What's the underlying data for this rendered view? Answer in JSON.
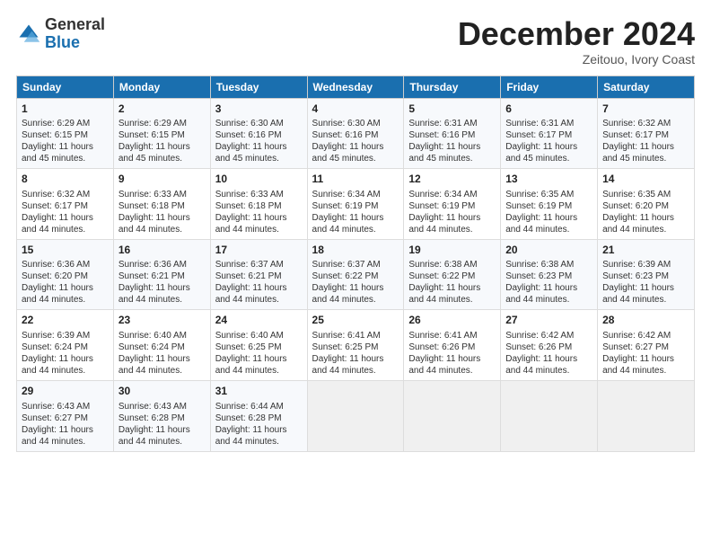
{
  "logo": {
    "general": "General",
    "blue": "Blue"
  },
  "title": "December 2024",
  "subtitle": "Zeitouo, Ivory Coast",
  "headers": [
    "Sunday",
    "Monday",
    "Tuesday",
    "Wednesday",
    "Thursday",
    "Friday",
    "Saturday"
  ],
  "weeks": [
    [
      {
        "day": "1",
        "lines": [
          "Sunrise: 6:29 AM",
          "Sunset: 6:15 PM",
          "Daylight: 11 hours",
          "and 45 minutes."
        ]
      },
      {
        "day": "2",
        "lines": [
          "Sunrise: 6:29 AM",
          "Sunset: 6:15 PM",
          "Daylight: 11 hours",
          "and 45 minutes."
        ]
      },
      {
        "day": "3",
        "lines": [
          "Sunrise: 6:30 AM",
          "Sunset: 6:16 PM",
          "Daylight: 11 hours",
          "and 45 minutes."
        ]
      },
      {
        "day": "4",
        "lines": [
          "Sunrise: 6:30 AM",
          "Sunset: 6:16 PM",
          "Daylight: 11 hours",
          "and 45 minutes."
        ]
      },
      {
        "day": "5",
        "lines": [
          "Sunrise: 6:31 AM",
          "Sunset: 6:16 PM",
          "Daylight: 11 hours",
          "and 45 minutes."
        ]
      },
      {
        "day": "6",
        "lines": [
          "Sunrise: 6:31 AM",
          "Sunset: 6:17 PM",
          "Daylight: 11 hours",
          "and 45 minutes."
        ]
      },
      {
        "day": "7",
        "lines": [
          "Sunrise: 6:32 AM",
          "Sunset: 6:17 PM",
          "Daylight: 11 hours",
          "and 45 minutes."
        ]
      }
    ],
    [
      {
        "day": "8",
        "lines": [
          "Sunrise: 6:32 AM",
          "Sunset: 6:17 PM",
          "Daylight: 11 hours",
          "and 44 minutes."
        ]
      },
      {
        "day": "9",
        "lines": [
          "Sunrise: 6:33 AM",
          "Sunset: 6:18 PM",
          "Daylight: 11 hours",
          "and 44 minutes."
        ]
      },
      {
        "day": "10",
        "lines": [
          "Sunrise: 6:33 AM",
          "Sunset: 6:18 PM",
          "Daylight: 11 hours",
          "and 44 minutes."
        ]
      },
      {
        "day": "11",
        "lines": [
          "Sunrise: 6:34 AM",
          "Sunset: 6:19 PM",
          "Daylight: 11 hours",
          "and 44 minutes."
        ]
      },
      {
        "day": "12",
        "lines": [
          "Sunrise: 6:34 AM",
          "Sunset: 6:19 PM",
          "Daylight: 11 hours",
          "and 44 minutes."
        ]
      },
      {
        "day": "13",
        "lines": [
          "Sunrise: 6:35 AM",
          "Sunset: 6:19 PM",
          "Daylight: 11 hours",
          "and 44 minutes."
        ]
      },
      {
        "day": "14",
        "lines": [
          "Sunrise: 6:35 AM",
          "Sunset: 6:20 PM",
          "Daylight: 11 hours",
          "and 44 minutes."
        ]
      }
    ],
    [
      {
        "day": "15",
        "lines": [
          "Sunrise: 6:36 AM",
          "Sunset: 6:20 PM",
          "Daylight: 11 hours",
          "and 44 minutes."
        ]
      },
      {
        "day": "16",
        "lines": [
          "Sunrise: 6:36 AM",
          "Sunset: 6:21 PM",
          "Daylight: 11 hours",
          "and 44 minutes."
        ]
      },
      {
        "day": "17",
        "lines": [
          "Sunrise: 6:37 AM",
          "Sunset: 6:21 PM",
          "Daylight: 11 hours",
          "and 44 minutes."
        ]
      },
      {
        "day": "18",
        "lines": [
          "Sunrise: 6:37 AM",
          "Sunset: 6:22 PM",
          "Daylight: 11 hours",
          "and 44 minutes."
        ]
      },
      {
        "day": "19",
        "lines": [
          "Sunrise: 6:38 AM",
          "Sunset: 6:22 PM",
          "Daylight: 11 hours",
          "and 44 minutes."
        ]
      },
      {
        "day": "20",
        "lines": [
          "Sunrise: 6:38 AM",
          "Sunset: 6:23 PM",
          "Daylight: 11 hours",
          "and 44 minutes."
        ]
      },
      {
        "day": "21",
        "lines": [
          "Sunrise: 6:39 AM",
          "Sunset: 6:23 PM",
          "Daylight: 11 hours",
          "and 44 minutes."
        ]
      }
    ],
    [
      {
        "day": "22",
        "lines": [
          "Sunrise: 6:39 AM",
          "Sunset: 6:24 PM",
          "Daylight: 11 hours",
          "and 44 minutes."
        ]
      },
      {
        "day": "23",
        "lines": [
          "Sunrise: 6:40 AM",
          "Sunset: 6:24 PM",
          "Daylight: 11 hours",
          "and 44 minutes."
        ]
      },
      {
        "day": "24",
        "lines": [
          "Sunrise: 6:40 AM",
          "Sunset: 6:25 PM",
          "Daylight: 11 hours",
          "and 44 minutes."
        ]
      },
      {
        "day": "25",
        "lines": [
          "Sunrise: 6:41 AM",
          "Sunset: 6:25 PM",
          "Daylight: 11 hours",
          "and 44 minutes."
        ]
      },
      {
        "day": "26",
        "lines": [
          "Sunrise: 6:41 AM",
          "Sunset: 6:26 PM",
          "Daylight: 11 hours",
          "and 44 minutes."
        ]
      },
      {
        "day": "27",
        "lines": [
          "Sunrise: 6:42 AM",
          "Sunset: 6:26 PM",
          "Daylight: 11 hours",
          "and 44 minutes."
        ]
      },
      {
        "day": "28",
        "lines": [
          "Sunrise: 6:42 AM",
          "Sunset: 6:27 PM",
          "Daylight: 11 hours",
          "and 44 minutes."
        ]
      }
    ],
    [
      {
        "day": "29",
        "lines": [
          "Sunrise: 6:43 AM",
          "Sunset: 6:27 PM",
          "Daylight: 11 hours",
          "and 44 minutes."
        ]
      },
      {
        "day": "30",
        "lines": [
          "Sunrise: 6:43 AM",
          "Sunset: 6:28 PM",
          "Daylight: 11 hours",
          "and 44 minutes."
        ]
      },
      {
        "day": "31",
        "lines": [
          "Sunrise: 6:44 AM",
          "Sunset: 6:28 PM",
          "Daylight: 11 hours",
          "and 44 minutes."
        ]
      },
      null,
      null,
      null,
      null
    ]
  ]
}
